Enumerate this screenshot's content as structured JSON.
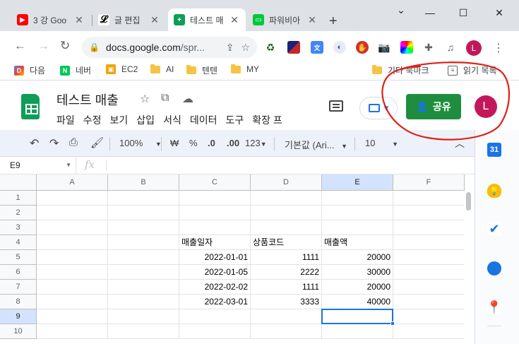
{
  "browser": {
    "tabs": [
      {
        "title": "3 강 Goo",
        "icon": "youtube-icon",
        "active": false
      },
      {
        "title": "글 편집",
        "icon": "l-logo-icon",
        "active": false
      },
      {
        "title": "테스트 매",
        "icon": "sheets-icon",
        "active": true
      },
      {
        "title": "파워비아",
        "icon": "naver-line-icon",
        "active": false
      }
    ],
    "url_host": "docs.google.com",
    "url_path": "/spr...",
    "profile_initial": "L"
  },
  "bookmarks": {
    "items": [
      {
        "label": "다음",
        "icon": "daum-icon"
      },
      {
        "label": "네버",
        "icon": "naver-icon"
      },
      {
        "label": "EC2",
        "icon": "aws-icon"
      },
      {
        "label": "AI",
        "icon": "folder-icon"
      },
      {
        "label": "텐텐",
        "icon": "folder-icon"
      },
      {
        "label": "MY",
        "icon": "folder-icon"
      }
    ],
    "other": "기타 북마크",
    "reading_list": "읽기 목록"
  },
  "doc": {
    "title": "테스트 매출",
    "menu": [
      "파일",
      "수정",
      "보기",
      "삽입",
      "서식",
      "데이터",
      "도구",
      "확장 프"
    ],
    "share_label": "공유",
    "account_initial": "L"
  },
  "toolbar": {
    "zoom": "100%",
    "currency": "₩",
    "percent": "%",
    "decrease_decimal": ".0",
    "increase_decimal": ".00",
    "number_format": "123",
    "font": "기본값 (Ari...",
    "font_size": "10"
  },
  "formula_bar": {
    "name_box": "E9",
    "fx_label": "fx"
  },
  "sheet": {
    "columns": [
      "A",
      "B",
      "C",
      "D",
      "E",
      "F"
    ],
    "rows": [
      "1",
      "2",
      "3",
      "4",
      "5",
      "6",
      "7",
      "8",
      "9",
      "10"
    ],
    "headers": {
      "date": "매출일자",
      "code": "상품코드",
      "amount": "매출액"
    },
    "data": [
      {
        "date": "2022-01-01",
        "code": "1111",
        "amount": "20000"
      },
      {
        "date": "2022-01-05",
        "code": "2222",
        "amount": "30000"
      },
      {
        "date": "2022-02-02",
        "code": "1111",
        "amount": "20000"
      },
      {
        "date": "2022-03-01",
        "code": "3333",
        "amount": "40000"
      }
    ]
  },
  "colors": {
    "sheets_green": "#0f9d58",
    "share_button": "#1e8e3e",
    "selection_blue": "#1a73e8",
    "annotation_red": "#e0201b",
    "avatar": "#c2185b"
  }
}
